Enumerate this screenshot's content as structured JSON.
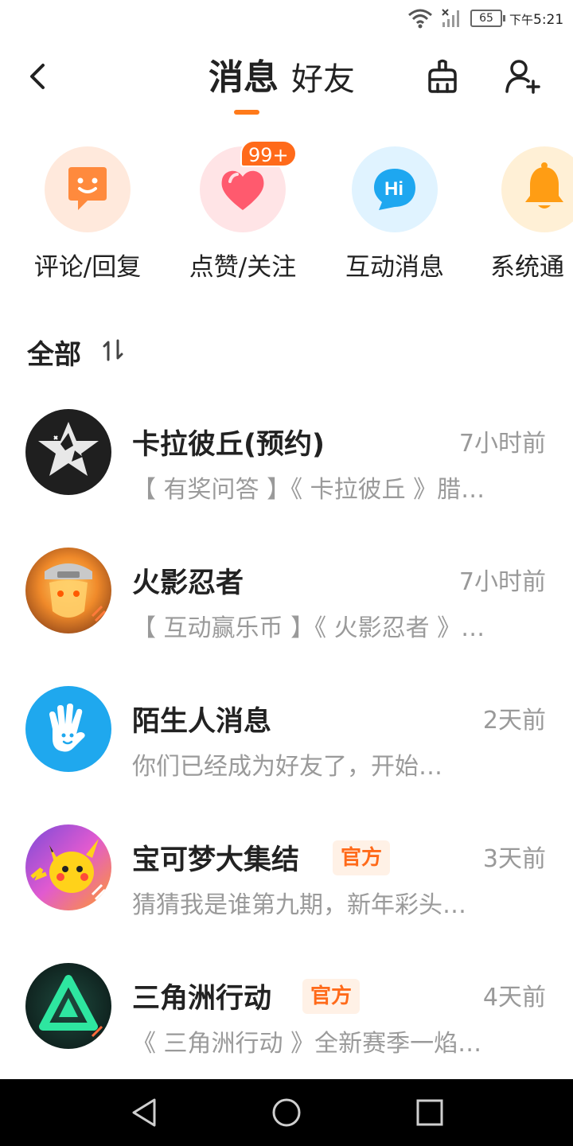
{
  "status_bar": {
    "battery": "65",
    "ampm": "下午",
    "time": "5:21"
  },
  "header": {
    "tabs": [
      {
        "label": "消息",
        "active": true
      },
      {
        "label": "好友",
        "active": false
      }
    ],
    "accent_color": "#ff7a1a",
    "icons": [
      "back-icon",
      "broom-icon",
      "add-friend-icon"
    ]
  },
  "quick_entries": [
    {
      "label": "评论/回复",
      "icon": "comment-icon",
      "bg": "#ffe9dc"
    },
    {
      "label": "点赞/关注",
      "icon": "heart-icon",
      "bg": "#ffe4e6",
      "badge": "99+"
    },
    {
      "label": "互动消息",
      "icon": "hi-icon",
      "bg": "#e0f3ff"
    },
    {
      "label": "系统通",
      "icon": "bell-icon",
      "bg": "#fff0d6"
    }
  ],
  "section": {
    "title": "全部",
    "sort_icon": "sort-icon"
  },
  "messages": [
    {
      "name": "卡拉彼丘(预约)",
      "time": "7小时前",
      "preview": "【 有奖问答 】《 卡拉彼丘 》腊…",
      "official": false
    },
    {
      "name": "火影忍者",
      "time": "7小时前",
      "preview": "【 互动赢乐币 】《 火影忍者 》…",
      "official": false
    },
    {
      "name": "陌生人消息",
      "time": "2天前",
      "preview": "你们已经成为好友了，开始…",
      "official": false
    },
    {
      "name": "宝可梦大集结",
      "time": "3天前",
      "preview": "猜猜我是谁第九期，新年彩头…",
      "official": true,
      "tag": "官方"
    },
    {
      "name": "三角洲行动",
      "time": "4天前",
      "preview": "《 三角洲行动 》全新赛季一焰…",
      "official": true,
      "tag": "官方"
    }
  ],
  "nav_bar": {
    "icons": [
      "nav-back-icon",
      "nav-home-icon",
      "nav-recent-icon"
    ]
  }
}
